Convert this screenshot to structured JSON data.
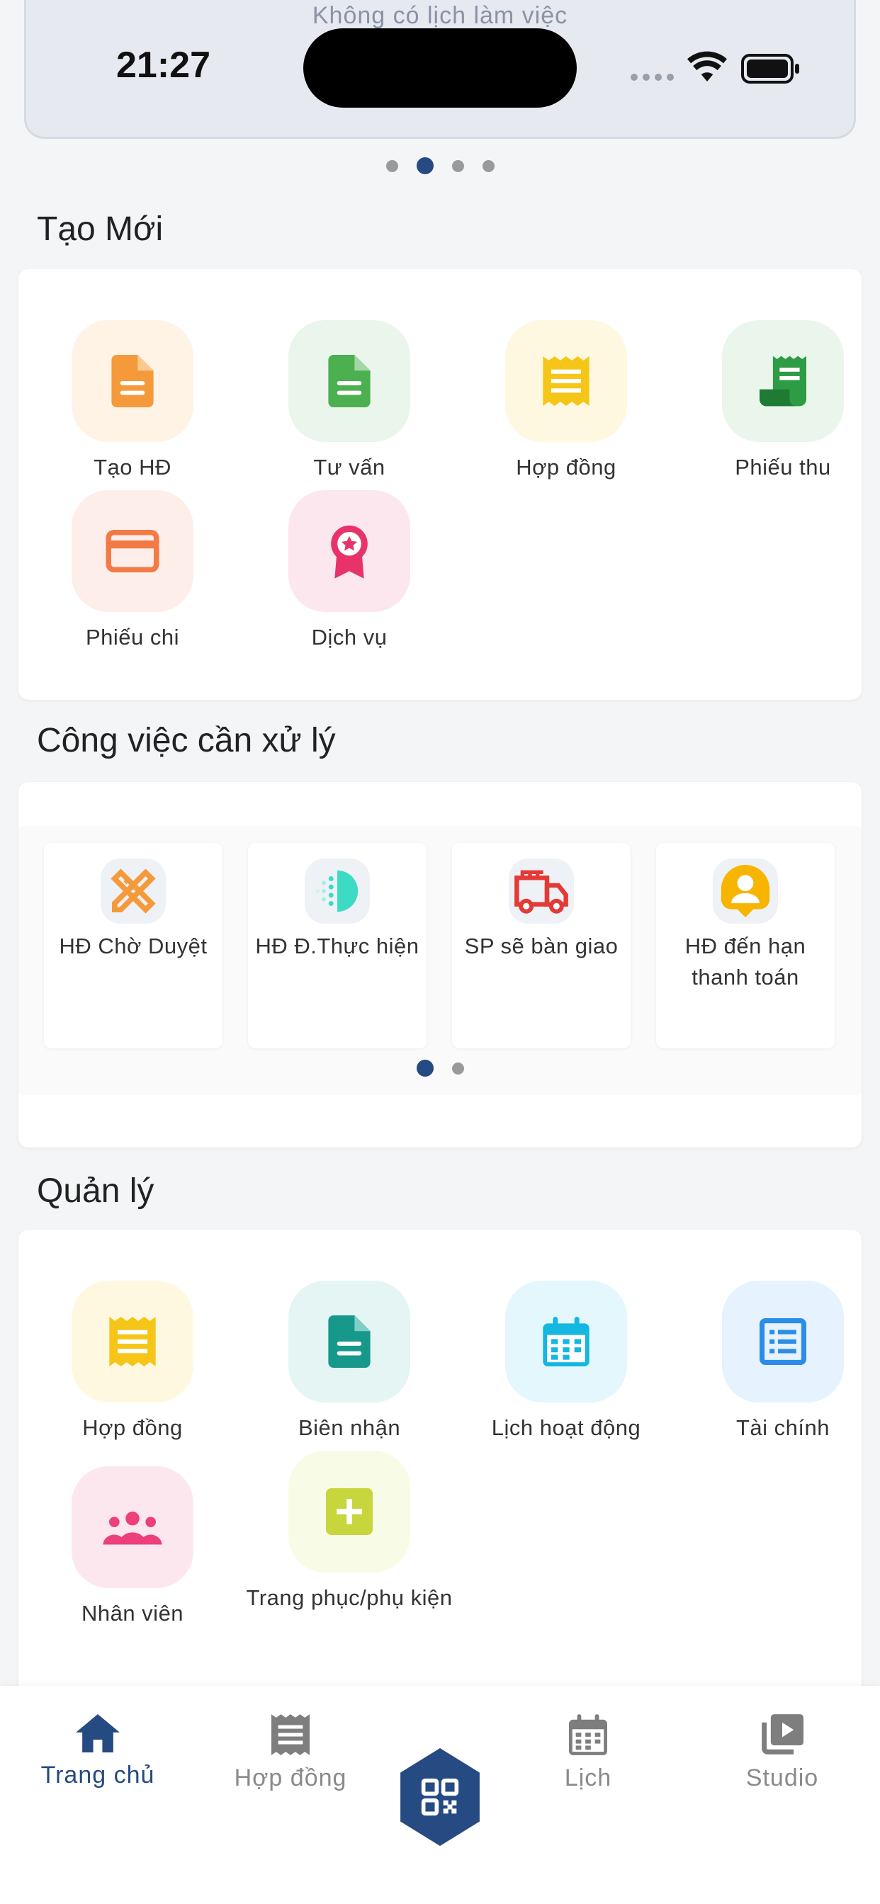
{
  "status_bar": {
    "time": "21:27"
  },
  "banner": {
    "text": "Không có lịch làm việc"
  },
  "create_section": {
    "title": "Tạo Mới",
    "items": [
      {
        "label": "Tạo HĐ",
        "icon": "document-icon",
        "color": "#f59a3b",
        "bg": "#fff3e6"
      },
      {
        "label": "Tư vấn",
        "icon": "document-icon",
        "color": "#4caf50",
        "bg": "#eaf6ec"
      },
      {
        "label": "Hợp đồng",
        "icon": "receipt-icon",
        "color": "#f5c518",
        "bg": "#fff8e1"
      },
      {
        "label": "Phiếu thu",
        "icon": "receipt-roll-icon",
        "color": "#2e9b45",
        "bg": "#eaf6ec"
      },
      {
        "label": "Phiếu chi",
        "icon": "credit-card-icon",
        "color": "#f27a45",
        "bg": "#fdeeea"
      },
      {
        "label": "Dịch vụ",
        "icon": "award-badge-icon",
        "color": "#e8336a",
        "bg": "#fde7ef"
      }
    ]
  },
  "tasks_section": {
    "title": "Công việc cần xử lý",
    "items": [
      {
        "label": "HĐ Chờ Duyệt",
        "icon": "ruler-pencil-icon",
        "color": "#f59a3b"
      },
      {
        "label": "HĐ Đ.Thực hiện",
        "icon": "half-moon-dots-icon",
        "color": "#3ddbc4"
      },
      {
        "label": "SP sẽ bàn giao",
        "icon": "fire-truck-icon",
        "color": "#e53935"
      },
      {
        "label": "HĐ đến hạn thanh toán",
        "icon": "user-pin-icon",
        "color": "#f7b500"
      }
    ]
  },
  "manage_section": {
    "title": "Quản lý",
    "items": [
      {
        "label": "Hợp đồng",
        "icon": "receipt-icon",
        "color": "#f5c518",
        "bg": "#fff8e1"
      },
      {
        "label": "Biên nhận",
        "icon": "document-icon",
        "color": "#16988a",
        "bg": "#e4f5f3"
      },
      {
        "label": "Lịch hoạt động",
        "icon": "calendar-icon",
        "color": "#13b7e0",
        "bg": "#e3f7fc"
      },
      {
        "label": "Tài chính",
        "icon": "list-icon",
        "color": "#2b8de6",
        "bg": "#e6f2fd"
      },
      {
        "label": "Nhân viên",
        "icon": "people-icon",
        "color": "#ec3f7c",
        "bg": "#fde7ef"
      },
      {
        "label": "Trang phục/phụ kiện",
        "icon": "add-box-icon",
        "color": "#c6d63c",
        "bg": "#f8fbe6"
      }
    ]
  },
  "bottom_nav": {
    "items": [
      {
        "label": "Trang chủ",
        "icon": "home-icon",
        "active": true
      },
      {
        "label": "Hợp đồng",
        "icon": "receipt-icon"
      },
      {
        "label": "",
        "icon": "qr-code-icon"
      },
      {
        "label": "Lịch",
        "icon": "calendar-icon"
      },
      {
        "label": "Studio",
        "icon": "video-library-icon"
      }
    ]
  },
  "colors": {
    "primary": "#264a82",
    "inactive": "#8a8a8a"
  }
}
